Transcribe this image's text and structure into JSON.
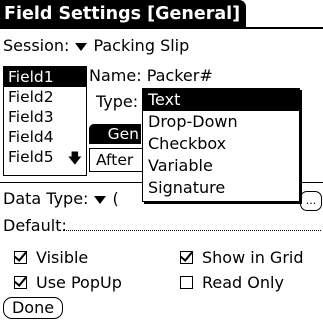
{
  "title": "Field Settings [General]",
  "session": {
    "label": "Session:",
    "value": "Packing Slip"
  },
  "fields": {
    "items": [
      "Field1",
      "Field2",
      "Field3",
      "Field4",
      "Field5"
    ],
    "selected": "Field1"
  },
  "name_row": {
    "label": "Name:",
    "value": "Packer#"
  },
  "type_row": {
    "label": "Type:"
  },
  "tabs": {
    "general_partial": "Gen",
    "after_partial": "After"
  },
  "type_dropdown": {
    "options": [
      "Text",
      "Drop-Down",
      "Checkbox",
      "Variable",
      "Signature"
    ],
    "selected": "Text"
  },
  "data_type": {
    "label": "Data Type:",
    "value_partial": "(",
    "button_partial": "..."
  },
  "default": {
    "label": "Default:",
    "value": ""
  },
  "checkboxes": {
    "visible": {
      "label": "Visible",
      "checked": true
    },
    "show_in_grid": {
      "label": "Show in Grid",
      "checked": true
    },
    "use_popup": {
      "label": "Use PopUp",
      "checked": true
    },
    "read_only": {
      "label": "Read Only",
      "checked": false
    }
  },
  "done_label": "Done",
  "icons": {
    "popup_trigger": "triangle-down-icon",
    "scroll": "scroll-down-arrow-icon",
    "check": "checkmark-icon"
  }
}
